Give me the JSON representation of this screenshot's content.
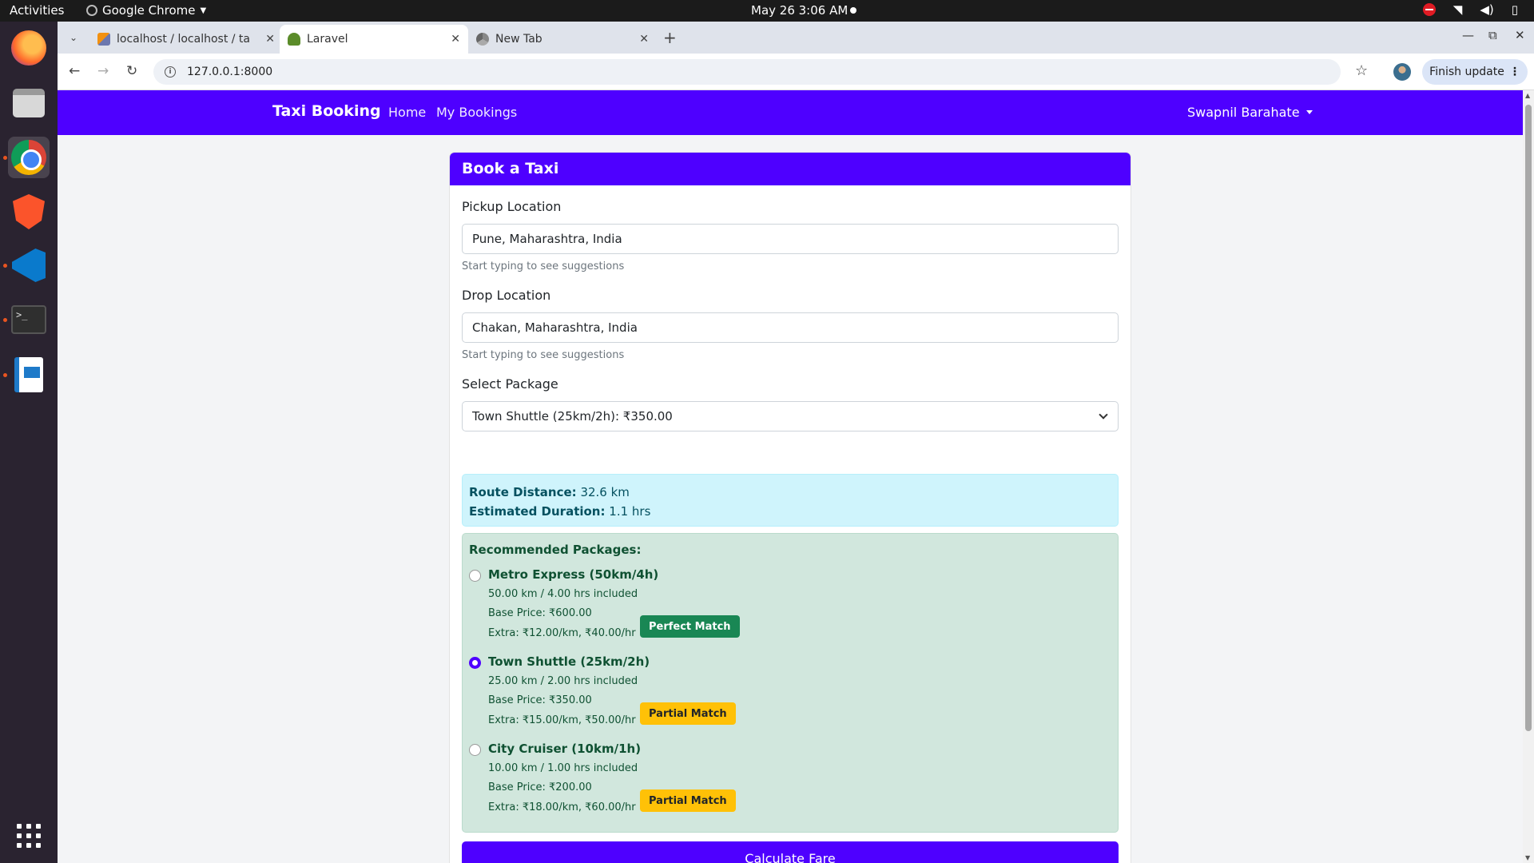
{
  "system": {
    "activities": "Activities",
    "app_name": "Google Chrome",
    "clock": "May 26  3:06 AM"
  },
  "dock": {
    "apps": [
      "firefox",
      "files",
      "chrome",
      "brave",
      "vscode",
      "terminal",
      "libreoffice-writer",
      "show-apps"
    ]
  },
  "browser": {
    "tabs": [
      {
        "title": "localhost / localhost / ta",
        "icon": "phpmyadmin-icon"
      },
      {
        "title": "Laravel",
        "icon": "taxi-icon",
        "active": true
      },
      {
        "title": "New Tab",
        "icon": "chrome-icon"
      }
    ],
    "url": "127.0.0.1:8000",
    "update_label": "Finish update"
  },
  "navbar": {
    "brand": "Taxi Booking",
    "links": [
      "Home",
      "My Bookings"
    ],
    "user": "Swapnil Barahate",
    "color": "#4e00ff"
  },
  "form": {
    "title": "Book a Taxi",
    "pickup": {
      "label": "Pickup Location",
      "value": "Pune, Maharashtra, India",
      "hint": "Start typing to see suggestions"
    },
    "drop": {
      "label": "Drop Location",
      "value": "Chakan, Maharashtra, India",
      "hint": "Start typing to see suggestions"
    },
    "package": {
      "label": "Select Package",
      "selected": "Town Shuttle (25km/2h): ₹350.00"
    },
    "route": {
      "distance_label": "Route Distance:",
      "distance_value": "32.6 km",
      "duration_label": "Estimated Duration:",
      "duration_value": "1.1 hrs"
    },
    "recommended": {
      "title": "Recommended Packages:",
      "packages": [
        {
          "name": "Metro Express (50km/4h)",
          "included": "50.00 km / 4.00 hrs included",
          "base": "Base Price: ₹600.00",
          "extra": "Extra: ₹12.00/km, ₹40.00/hr",
          "match": "Perfect Match",
          "checked": false
        },
        {
          "name": "Town Shuttle (25km/2h)",
          "included": "25.00 km / 2.00 hrs included",
          "base": "Base Price: ₹350.00",
          "extra": "Extra: ₹15.00/km, ₹50.00/hr",
          "match": "Partial Match",
          "checked": true
        },
        {
          "name": "City Cruiser (10km/1h)",
          "included": "10.00 km / 1.00 hrs included",
          "base": "Base Price: ₹200.00",
          "extra": "Extra: ₹18.00/km, ₹60.00/hr",
          "match": "Partial Match",
          "checked": false
        }
      ]
    },
    "calculate_label": "Calculate Fare"
  }
}
